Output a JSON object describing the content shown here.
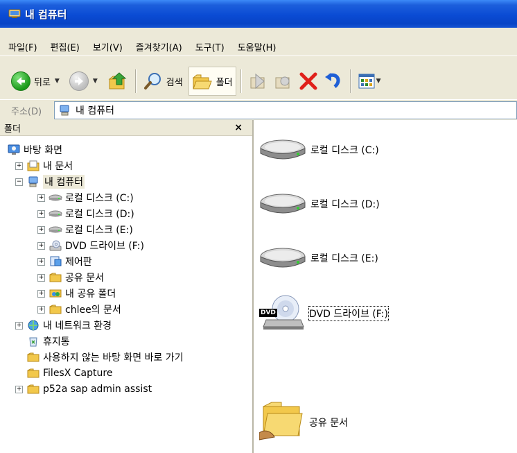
{
  "window": {
    "title": "내 컴퓨터"
  },
  "menu": [
    "파일(F)",
    "편집(E)",
    "보기(V)",
    "즐겨찾기(A)",
    "도구(T)",
    "도움말(H)"
  ],
  "toolbar": {
    "back_label": "뒤로",
    "search_label": "검색",
    "folders_label": "폴더"
  },
  "address": {
    "label": "주소(D)",
    "value": "내 컴퓨터"
  },
  "folders_pane": {
    "header": "폴더",
    "close_glyph": "×",
    "tree": [
      {
        "label": "바탕 화면",
        "expander": "",
        "icon": "desktop-icon"
      },
      {
        "label": "내 문서",
        "expander": "+",
        "icon": "my-documents-icon"
      },
      {
        "label": "내 컴퓨터",
        "expander": "−",
        "icon": "my-computer-icon",
        "selected": true
      },
      {
        "label": "로컬 디스크 (C:)",
        "expander": "+",
        "icon": "hard-disk-icon"
      },
      {
        "label": "로컬 디스크 (D:)",
        "expander": "+",
        "icon": "hard-disk-icon"
      },
      {
        "label": "로컬 디스크 (E:)",
        "expander": "+",
        "icon": "hard-disk-icon"
      },
      {
        "label": "DVD 드라이브 (F:)",
        "expander": "+",
        "icon": "dvd-drive-icon"
      },
      {
        "label": "제어판",
        "expander": "+",
        "icon": "control-panel-icon"
      },
      {
        "label": "공유 문서",
        "expander": "+",
        "icon": "folder-icon"
      },
      {
        "label": "내 공유 폴더",
        "expander": "+",
        "icon": "shared-folder-icon"
      },
      {
        "label": "chlee의 문서",
        "expander": "+",
        "icon": "folder-icon"
      },
      {
        "label": "내 네트워크 환경",
        "expander": "+",
        "icon": "network-icon"
      },
      {
        "label": "휴지통",
        "expander": "",
        "icon": "recycle-bin-icon"
      },
      {
        "label": "사용하지 않는 바탕 화면 바로 가기",
        "expander": "",
        "icon": "folder-icon"
      },
      {
        "label": "FilesX Capture",
        "expander": "",
        "icon": "folder-icon"
      },
      {
        "label": "p52a sap admin assist",
        "expander": "+",
        "icon": "folder-icon"
      }
    ]
  },
  "content": {
    "items": [
      {
        "label": "로컬 디스크 (C:)",
        "icon": "hard-disk-icon"
      },
      {
        "label": "로컬 디스크 (D:)",
        "icon": "hard-disk-icon"
      },
      {
        "label": "로컬 디스크 (E:)",
        "icon": "hard-disk-icon"
      },
      {
        "label": "DVD 드라이브 (F:)",
        "icon": "dvd-drive-icon",
        "badge": "DVD"
      },
      {
        "label": "공유 문서",
        "icon": "shared-folder-icon"
      }
    ]
  },
  "colors": {
    "titlebar": "#0a4bd4",
    "chrome": "#ece9d8",
    "pane": "#ffffff"
  }
}
